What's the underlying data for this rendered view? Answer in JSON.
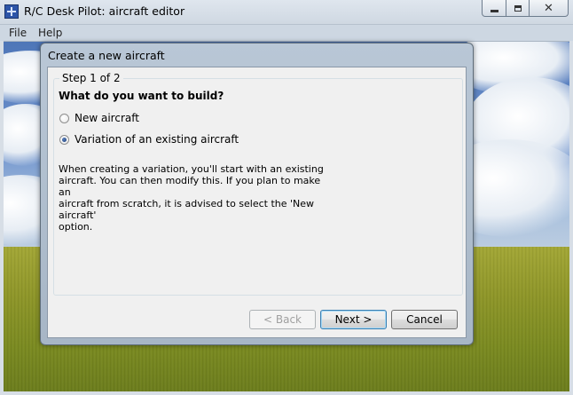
{
  "window": {
    "title": "R/C Desk Pilot: aircraft editor",
    "controls": {
      "minimize_icon": "minimize-icon",
      "maximize_icon": "maximize-icon",
      "close_icon": "close-icon",
      "close_glyph": "✕"
    }
  },
  "menu": {
    "items": [
      "File",
      "Help"
    ]
  },
  "dialog": {
    "title": "Create a new aircraft",
    "step_label": "Step 1 of 2",
    "question": "What do you want to build?",
    "options": [
      {
        "label": "New aircraft",
        "checked": false
      },
      {
        "label": "Variation of an existing aircraft",
        "checked": true
      }
    ],
    "description_lines": [
      "When creating a variation, you'll start with an existing",
      "aircraft. You can then modify this. If you plan to make an",
      "aircraft from scratch, it is advised to select the 'New aircraft'",
      "option."
    ],
    "buttons": {
      "back": "< Back",
      "next": "Next >",
      "cancel": "Cancel"
    }
  },
  "colors": {
    "sky": "#6f93cd",
    "grass": "#8e9628",
    "dialog_frame": "#b9c7d6",
    "dialog_body": "#f0f0f0",
    "focus_border": "#3c7fb1"
  }
}
